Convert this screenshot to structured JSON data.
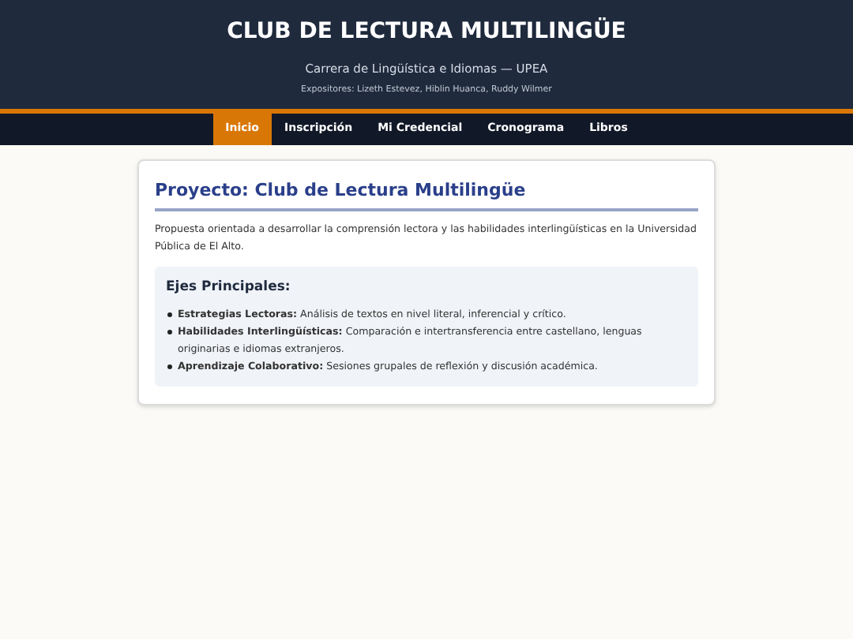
{
  "header": {
    "title": "CLUB DE LECTURA MULTILINGÜE",
    "subtitle": "Carrera de Lingüística e Idiomas — UPEA",
    "presenters": "Expositores: Lizeth Estevez, Hiblin Huanca, Ruddy Wilmer"
  },
  "nav": [
    {
      "label": "Inicio",
      "selected": true
    },
    {
      "label": "Inscripción",
      "selected": false
    },
    {
      "label": "Mi Credencial",
      "selected": false
    },
    {
      "label": "Cronograma",
      "selected": false
    },
    {
      "label": "Libros",
      "selected": false
    }
  ],
  "card": {
    "title": "Proyecto: Club de Lectura Multilingüe",
    "description": "Propuesta orientada a desarrollar la comprensión lectora y las habilidades interlingüísticas en la Universidad Pública de El Alto.",
    "axes": {
      "heading": "Ejes Principales:",
      "items": [
        "**Estrategias Lectoras:** Análisis de textos en nivel literal, inferencial y crítico.",
        "**Habilidades Interlingüísticas:** Comparación e intertransferencia entre castellano, lenguas originarias e idiomas extranjeros.",
        "**Aprendizaje Colaborativo:** Sesiones grupales de reflexión y discusión académica."
      ]
    }
  }
}
